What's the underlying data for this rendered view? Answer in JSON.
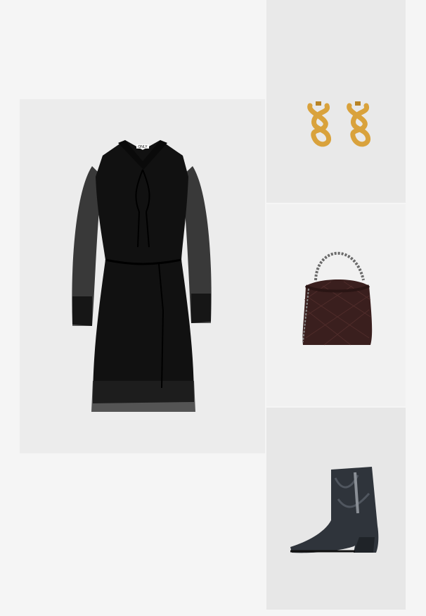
{
  "outfit": {
    "items": [
      {
        "id": "dress",
        "icon": "black-dress-image",
        "brand_tag": "ONLY"
      },
      {
        "id": "earrings",
        "icon": "gold-earrings-image"
      },
      {
        "id": "bag",
        "icon": "quilted-bag-image"
      },
      {
        "id": "boots",
        "icon": "western-boot-image"
      }
    ]
  },
  "colors": {
    "page_bg": "#f5f5f5",
    "dress": "#111111",
    "gold": "#d9a23c",
    "bag": "#3a1f1e",
    "boot": "#2f343b"
  }
}
